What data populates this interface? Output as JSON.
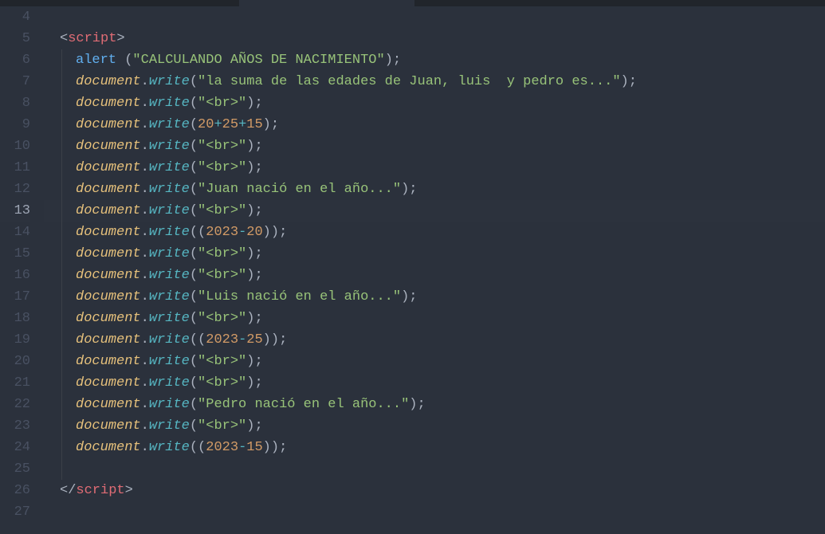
{
  "tabs": {
    "active_index": 1
  },
  "gutter": {
    "start": 4,
    "end": 27,
    "current": 13
  },
  "code": {
    "lines": [
      {
        "n": 4,
        "indent": 0,
        "tokens": []
      },
      {
        "n": 5,
        "indent": 1,
        "tokens": [
          {
            "t": "<",
            "c": "punct"
          },
          {
            "t": "script",
            "c": "tag"
          },
          {
            "t": ">",
            "c": "punct"
          }
        ]
      },
      {
        "n": 6,
        "indent": 2,
        "tokens": [
          {
            "t": "alert ",
            "c": "func"
          },
          {
            "t": "(",
            "c": "bracket"
          },
          {
            "t": "\"CALCULANDO AÑOS DE NACIMIENTO\"",
            "c": "string"
          },
          {
            "t": ")",
            "c": "bracket"
          },
          {
            "t": ";",
            "c": "semi"
          }
        ]
      },
      {
        "n": 7,
        "indent": 2,
        "tokens": [
          {
            "t": "document",
            "c": "italic-dom"
          },
          {
            "t": ".",
            "c": "punct"
          },
          {
            "t": "write",
            "c": "method-italic"
          },
          {
            "t": "(",
            "c": "bracket"
          },
          {
            "t": "\"la suma de las edades de Juan, luis  y pedro es...\"",
            "c": "string"
          },
          {
            "t": ")",
            "c": "bracket"
          },
          {
            "t": ";",
            "c": "semi"
          }
        ]
      },
      {
        "n": 8,
        "indent": 2,
        "tokens": [
          {
            "t": "document",
            "c": "italic-dom"
          },
          {
            "t": ".",
            "c": "punct"
          },
          {
            "t": "write",
            "c": "method-italic"
          },
          {
            "t": "(",
            "c": "bracket"
          },
          {
            "t": "\"<br>\"",
            "c": "string"
          },
          {
            "t": ")",
            "c": "bracket"
          },
          {
            "t": ";",
            "c": "semi"
          }
        ]
      },
      {
        "n": 9,
        "indent": 2,
        "tokens": [
          {
            "t": "document",
            "c": "italic-dom"
          },
          {
            "t": ".",
            "c": "punct"
          },
          {
            "t": "write",
            "c": "method-italic"
          },
          {
            "t": "(",
            "c": "bracket"
          },
          {
            "t": "20",
            "c": "number"
          },
          {
            "t": "+",
            "c": "op"
          },
          {
            "t": "25",
            "c": "number"
          },
          {
            "t": "+",
            "c": "op"
          },
          {
            "t": "15",
            "c": "number"
          },
          {
            "t": ")",
            "c": "bracket"
          },
          {
            "t": ";",
            "c": "semi"
          }
        ]
      },
      {
        "n": 10,
        "indent": 2,
        "tokens": [
          {
            "t": "document",
            "c": "italic-dom"
          },
          {
            "t": ".",
            "c": "punct"
          },
          {
            "t": "write",
            "c": "method-italic"
          },
          {
            "t": "(",
            "c": "bracket"
          },
          {
            "t": "\"<br>\"",
            "c": "string"
          },
          {
            "t": ")",
            "c": "bracket"
          },
          {
            "t": ";",
            "c": "semi"
          }
        ]
      },
      {
        "n": 11,
        "indent": 2,
        "tokens": [
          {
            "t": "document",
            "c": "italic-dom"
          },
          {
            "t": ".",
            "c": "punct"
          },
          {
            "t": "write",
            "c": "method-italic"
          },
          {
            "t": "(",
            "c": "bracket"
          },
          {
            "t": "\"<br>\"",
            "c": "string"
          },
          {
            "t": ")",
            "c": "bracket"
          },
          {
            "t": ";",
            "c": "semi"
          }
        ]
      },
      {
        "n": 12,
        "indent": 2,
        "tokens": [
          {
            "t": "document",
            "c": "italic-dom"
          },
          {
            "t": ".",
            "c": "punct"
          },
          {
            "t": "write",
            "c": "method-italic"
          },
          {
            "t": "(",
            "c": "bracket"
          },
          {
            "t": "\"Juan nació en el año...\"",
            "c": "string"
          },
          {
            "t": ")",
            "c": "bracket"
          },
          {
            "t": ";",
            "c": "semi"
          }
        ]
      },
      {
        "n": 13,
        "indent": 2,
        "current": true,
        "tokens": [
          {
            "t": "document",
            "c": "italic-dom"
          },
          {
            "t": ".",
            "c": "punct"
          },
          {
            "t": "write",
            "c": "method-italic"
          },
          {
            "t": "(",
            "c": "bracket"
          },
          {
            "t": "\"<br>\"",
            "c": "string"
          },
          {
            "t": ")",
            "c": "bracket"
          },
          {
            "t": ";",
            "c": "semi"
          }
        ]
      },
      {
        "n": 14,
        "indent": 2,
        "tokens": [
          {
            "t": "document",
            "c": "italic-dom"
          },
          {
            "t": ".",
            "c": "punct"
          },
          {
            "t": "write",
            "c": "method-italic"
          },
          {
            "t": "(",
            "c": "bracket"
          },
          {
            "t": "(",
            "c": "bracket"
          },
          {
            "t": "2023",
            "c": "number"
          },
          {
            "t": "-",
            "c": "op"
          },
          {
            "t": "20",
            "c": "number"
          },
          {
            "t": ")",
            "c": "bracket"
          },
          {
            "t": ")",
            "c": "bracket"
          },
          {
            "t": ";",
            "c": "semi"
          }
        ]
      },
      {
        "n": 15,
        "indent": 2,
        "tokens": [
          {
            "t": "document",
            "c": "italic-dom"
          },
          {
            "t": ".",
            "c": "punct"
          },
          {
            "t": "write",
            "c": "method-italic"
          },
          {
            "t": "(",
            "c": "bracket"
          },
          {
            "t": "\"<br>\"",
            "c": "string"
          },
          {
            "t": ")",
            "c": "bracket"
          },
          {
            "t": ";",
            "c": "semi"
          }
        ]
      },
      {
        "n": 16,
        "indent": 2,
        "tokens": [
          {
            "t": "document",
            "c": "italic-dom"
          },
          {
            "t": ".",
            "c": "punct"
          },
          {
            "t": "write",
            "c": "method-italic"
          },
          {
            "t": "(",
            "c": "bracket"
          },
          {
            "t": "\"<br>\"",
            "c": "string"
          },
          {
            "t": ")",
            "c": "bracket"
          },
          {
            "t": ";",
            "c": "semi"
          }
        ]
      },
      {
        "n": 17,
        "indent": 2,
        "tokens": [
          {
            "t": "document",
            "c": "italic-dom"
          },
          {
            "t": ".",
            "c": "punct"
          },
          {
            "t": "write",
            "c": "method-italic"
          },
          {
            "t": "(",
            "c": "bracket"
          },
          {
            "t": "\"Luis nació en el año...\"",
            "c": "string"
          },
          {
            "t": ")",
            "c": "bracket"
          },
          {
            "t": ";",
            "c": "semi"
          }
        ]
      },
      {
        "n": 18,
        "indent": 2,
        "tokens": [
          {
            "t": "document",
            "c": "italic-dom"
          },
          {
            "t": ".",
            "c": "punct"
          },
          {
            "t": "write",
            "c": "method-italic"
          },
          {
            "t": "(",
            "c": "bracket"
          },
          {
            "t": "\"<br>\"",
            "c": "string"
          },
          {
            "t": ")",
            "c": "bracket"
          },
          {
            "t": ";",
            "c": "semi"
          }
        ]
      },
      {
        "n": 19,
        "indent": 2,
        "tokens": [
          {
            "t": "document",
            "c": "italic-dom"
          },
          {
            "t": ".",
            "c": "punct"
          },
          {
            "t": "write",
            "c": "method-italic"
          },
          {
            "t": "(",
            "c": "bracket"
          },
          {
            "t": "(",
            "c": "bracket"
          },
          {
            "t": "2023",
            "c": "number"
          },
          {
            "t": "-",
            "c": "op"
          },
          {
            "t": "25",
            "c": "number"
          },
          {
            "t": ")",
            "c": "bracket"
          },
          {
            "t": ")",
            "c": "bracket"
          },
          {
            "t": ";",
            "c": "semi"
          }
        ]
      },
      {
        "n": 20,
        "indent": 2,
        "tokens": [
          {
            "t": "document",
            "c": "italic-dom"
          },
          {
            "t": ".",
            "c": "punct"
          },
          {
            "t": "write",
            "c": "method-italic"
          },
          {
            "t": "(",
            "c": "bracket"
          },
          {
            "t": "\"<br>\"",
            "c": "string"
          },
          {
            "t": ")",
            "c": "bracket"
          },
          {
            "t": ";",
            "c": "semi"
          }
        ]
      },
      {
        "n": 21,
        "indent": 2,
        "tokens": [
          {
            "t": "document",
            "c": "italic-dom"
          },
          {
            "t": ".",
            "c": "punct"
          },
          {
            "t": "write",
            "c": "method-italic"
          },
          {
            "t": "(",
            "c": "bracket"
          },
          {
            "t": "\"<br>\"",
            "c": "string"
          },
          {
            "t": ")",
            "c": "bracket"
          },
          {
            "t": ";",
            "c": "semi"
          }
        ]
      },
      {
        "n": 22,
        "indent": 2,
        "tokens": [
          {
            "t": "document",
            "c": "italic-dom"
          },
          {
            "t": ".",
            "c": "punct"
          },
          {
            "t": "write",
            "c": "method-italic"
          },
          {
            "t": "(",
            "c": "bracket"
          },
          {
            "t": "\"Pedro nació en el año...\"",
            "c": "string"
          },
          {
            "t": ")",
            "c": "bracket"
          },
          {
            "t": ";",
            "c": "semi"
          }
        ]
      },
      {
        "n": 23,
        "indent": 2,
        "tokens": [
          {
            "t": "document",
            "c": "italic-dom"
          },
          {
            "t": ".",
            "c": "punct"
          },
          {
            "t": "write",
            "c": "method-italic"
          },
          {
            "t": "(",
            "c": "bracket"
          },
          {
            "t": "\"<br>\"",
            "c": "string"
          },
          {
            "t": ")",
            "c": "bracket"
          },
          {
            "t": ";",
            "c": "semi"
          }
        ]
      },
      {
        "n": 24,
        "indent": 2,
        "tokens": [
          {
            "t": "document",
            "c": "italic-dom"
          },
          {
            "t": ".",
            "c": "punct"
          },
          {
            "t": "write",
            "c": "method-italic"
          },
          {
            "t": "(",
            "c": "bracket"
          },
          {
            "t": "(",
            "c": "bracket"
          },
          {
            "t": "2023",
            "c": "number"
          },
          {
            "t": "-",
            "c": "op"
          },
          {
            "t": "15",
            "c": "number"
          },
          {
            "t": ")",
            "c": "bracket"
          },
          {
            "t": ")",
            "c": "bracket"
          },
          {
            "t": ";",
            "c": "semi"
          }
        ]
      },
      {
        "n": 25,
        "indent": 0,
        "tokens": []
      },
      {
        "n": 26,
        "indent": 1,
        "tokens": [
          {
            "t": "</",
            "c": "punct"
          },
          {
            "t": "script",
            "c": "tag"
          },
          {
            "t": ">",
            "c": "punct"
          }
        ]
      },
      {
        "n": 27,
        "indent": 0,
        "tokens": []
      }
    ]
  }
}
